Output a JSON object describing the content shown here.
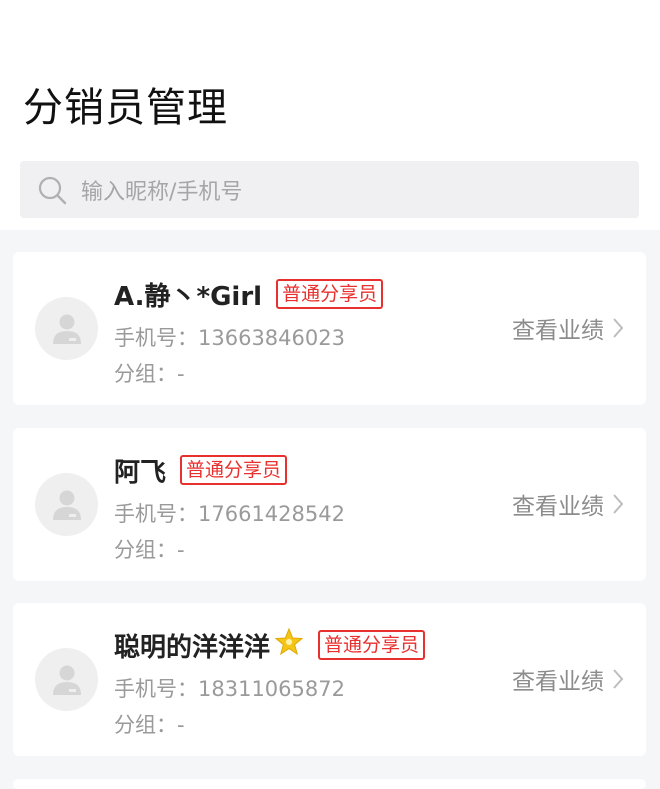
{
  "page": {
    "title": "分销员管理"
  },
  "search": {
    "placeholder": "输入昵称/手机号"
  },
  "distributors": [
    {
      "name": "A.静丶*Girl",
      "tag": "普通分享员",
      "phone_label": "手机号：",
      "phone": "13663846023",
      "group_label": "分组：",
      "group": "-",
      "action": "查看业绩"
    },
    {
      "name": "阿飞",
      "tag": "普通分享员",
      "phone_label": "手机号：",
      "phone": "17661428542",
      "group_label": "分组：",
      "group": "-",
      "action": "查看业绩"
    },
    {
      "name": "聪明的洋洋洋",
      "tag": "普通分享员",
      "phone_label": "手机号：",
      "phone": "18311065872",
      "group_label": "分组：",
      "group": "-",
      "action": "查看业绩",
      "badge_icon": "star-icon"
    }
  ],
  "colors": {
    "accent": "#e8312f",
    "muted": "#9a9a9a",
    "background": "#f5f6f8"
  }
}
